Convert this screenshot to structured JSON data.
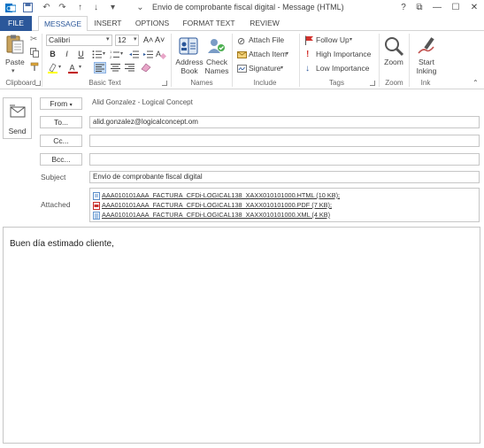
{
  "window": {
    "title": "Envio de comprobante fiscal digital - Message (HTML)",
    "controls": [
      "?",
      "⧉",
      "—",
      "☐",
      "✕"
    ]
  },
  "tabs": [
    {
      "label": "FILE"
    },
    {
      "label": "MESSAGE"
    },
    {
      "label": "INSERT"
    },
    {
      "label": "OPTIONS"
    },
    {
      "label": "FORMAT TEXT"
    },
    {
      "label": "REVIEW"
    }
  ],
  "ribbon": {
    "clipboard": {
      "paste": "Paste",
      "group": "Clipboard"
    },
    "basic_text": {
      "font": "Calibri",
      "size": "12",
      "group": "Basic Text",
      "bold": "B",
      "italic": "I",
      "underline": "U",
      "grow": "A˄",
      "shrink": "A˅"
    },
    "names": {
      "address_book_1": "Address",
      "address_book_2": "Book",
      "check_names_1": "Check",
      "check_names_2": "Names",
      "group": "Names"
    },
    "include": {
      "attach_file": "Attach File",
      "attach_item": "Attach Item",
      "signature": "Signature",
      "group": "Include"
    },
    "tags": {
      "follow_up": "Follow Up",
      "high_importance": "High Importance",
      "low_importance": "Low Importance",
      "group": "Tags"
    },
    "zoom": {
      "zoom": "Zoom",
      "group": "Zoom"
    },
    "ink": {
      "start_1": "Start",
      "start_2": "Inking",
      "group": "Ink"
    }
  },
  "compose": {
    "send": "Send",
    "from_button": "From",
    "from_value": "Alid Gonzalez - Logical Concept",
    "to_button": "To...",
    "to_value": "alid.gonzalez@logicalconcept.om",
    "cc_button": "Cc...",
    "cc_value": "",
    "bcc_button": "Bcc...",
    "bcc_value": "",
    "subject_label": "Subject",
    "subject_value": "Envio de comprobante fiscal digital",
    "attached_label": "Attached",
    "attachments": [
      {
        "name": "AAA010101AAA_FACTURA_CFDi-LOGICAL138_XAXX010101000.HTML (10 KB);",
        "icon": "html-file-icon",
        "color": "#5a8dc9"
      },
      {
        "name": "AAA010101AAA_FACTURA_CFDi-LOGICAL138_XAXX010101000.PDF (7 KB);",
        "icon": "pdf-file-icon",
        "color": "#c8302c"
      },
      {
        "name": "AAA010101AAA_FACTURA_CFDi-LOGICAL138_XAXX010101000.XML (4 KB)",
        "icon": "xml-file-icon",
        "color": "#6a9bd1"
      }
    ],
    "body": "Buen día estimado cliente,"
  },
  "colors": {
    "accent": "#2b579a",
    "border": "#c6c6c6"
  }
}
